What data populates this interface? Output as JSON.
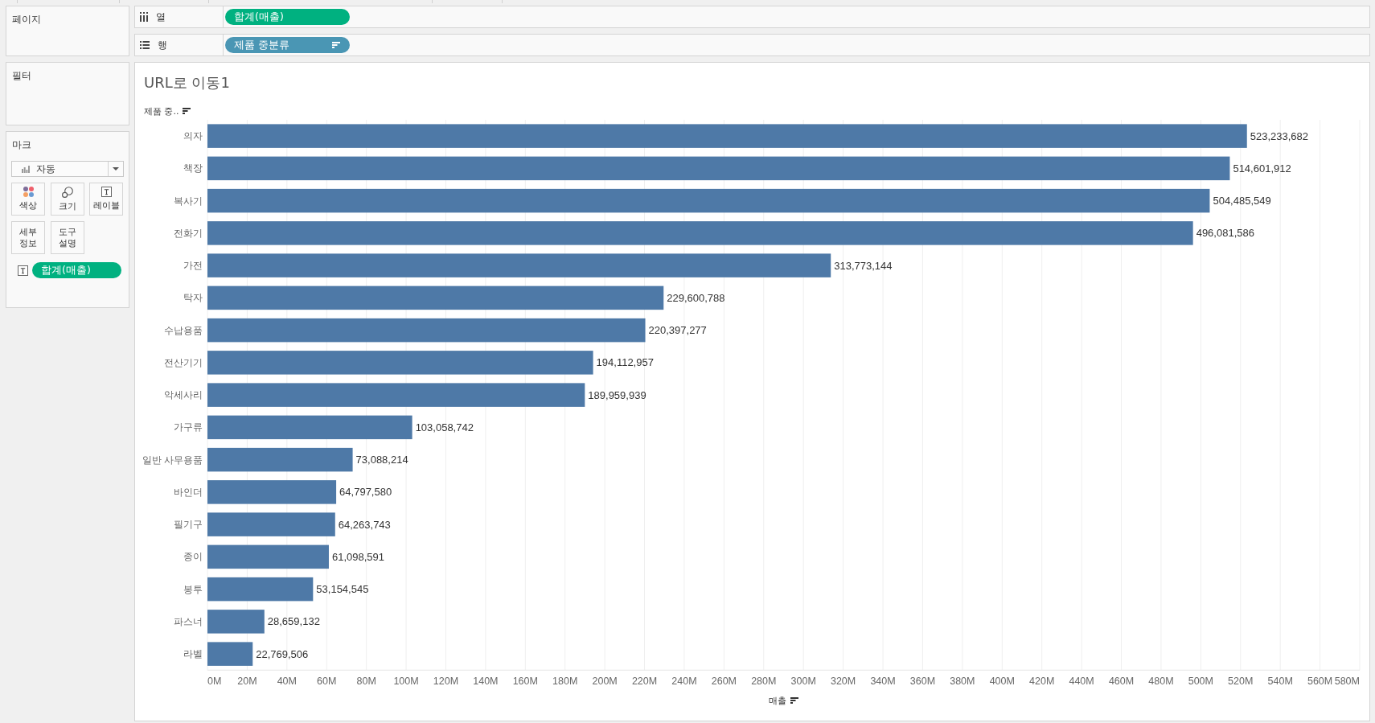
{
  "left_panel": {
    "cards": [
      {
        "kind": "pages",
        "title": "페이지"
      },
      {
        "kind": "filters",
        "title": "필터"
      },
      {
        "kind": "marks",
        "title": "마크",
        "mark_type": "자동",
        "buttons": [
          {
            "kind": "color",
            "label": "색상"
          },
          {
            "kind": "size",
            "label": "크기"
          },
          {
            "kind": "label",
            "label": "레이블"
          },
          {
            "kind": "detail",
            "label": "세부 정보"
          },
          {
            "kind": "tooltip",
            "label": "도구 설명"
          }
        ],
        "fields": [
          {
            "kind": "label",
            "pill": {
              "text": "합계(매출)",
              "kind": "measure",
              "sorted": false
            }
          }
        ]
      }
    ]
  },
  "shelves": [
    {
      "kind": "columns",
      "label": "열",
      "pills": [
        {
          "text": "합계(매출)",
          "kind": "measure",
          "sorted": false
        }
      ]
    },
    {
      "kind": "rows",
      "label": "행",
      "pills": [
        {
          "text": "제품 중분류",
          "kind": "dimension",
          "sorted": true
        }
      ]
    }
  ],
  "view": {
    "title": "URL로 이동1",
    "row_header_sorted": true,
    "axis_title_sorted": true,
    "chart_data": {
      "type": "bar",
      "orientation": "horizontal",
      "grid": true,
      "ylabel": "제품 중..",
      "xlabel": "매출",
      "categories": [
        "의자",
        "책장",
        "복사기",
        "전화기",
        "가전",
        "탁자",
        "수납용품",
        "전산기기",
        "악세사리",
        "가구류",
        "일반 사무용품",
        "바인더",
        "필기구",
        "종이",
        "봉투",
        "파스너",
        "라벨"
      ],
      "values": [
        523233682,
        514601912,
        504485549,
        496081586,
        313773144,
        229600788,
        220397277,
        194112957,
        189959939,
        103058742,
        73088214,
        64797580,
        64263743,
        61098591,
        53154545,
        28659132,
        22769506
      ],
      "value_labels": [
        "523,233,682",
        "514,601,912",
        "504,485,549",
        "496,081,586",
        "313,773,144",
        "229,600,788",
        "220,397,277",
        "194,112,957",
        "189,959,939",
        "103,058,742",
        "73,088,214",
        "64,797,580",
        "64,263,743",
        "61,098,591",
        "53,154,545",
        "28,659,132",
        "22,769,506"
      ],
      "xlim": [
        0,
        580000000
      ],
      "xticks": [
        {
          "value": 0,
          "label": "0M"
        },
        {
          "value": 20000000,
          "label": "20M"
        },
        {
          "value": 40000000,
          "label": "40M"
        },
        {
          "value": 60000000,
          "label": "60M"
        },
        {
          "value": 80000000,
          "label": "80M"
        },
        {
          "value": 100000000,
          "label": "100M"
        },
        {
          "value": 120000000,
          "label": "120M"
        },
        {
          "value": 140000000,
          "label": "140M"
        },
        {
          "value": 160000000,
          "label": "160M"
        },
        {
          "value": 180000000,
          "label": "180M"
        },
        {
          "value": 200000000,
          "label": "200M"
        },
        {
          "value": 220000000,
          "label": "220M"
        },
        {
          "value": 240000000,
          "label": "240M"
        },
        {
          "value": 260000000,
          "label": "260M"
        },
        {
          "value": 280000000,
          "label": "280M"
        },
        {
          "value": 300000000,
          "label": "300M"
        },
        {
          "value": 320000000,
          "label": "320M"
        },
        {
          "value": 340000000,
          "label": "340M"
        },
        {
          "value": 360000000,
          "label": "360M"
        },
        {
          "value": 380000000,
          "label": "380M"
        },
        {
          "value": 400000000,
          "label": "400M"
        },
        {
          "value": 420000000,
          "label": "420M"
        },
        {
          "value": 440000000,
          "label": "440M"
        },
        {
          "value": 460000000,
          "label": "460M"
        },
        {
          "value": 480000000,
          "label": "480M"
        },
        {
          "value": 500000000,
          "label": "500M"
        },
        {
          "value": 520000000,
          "label": "520M"
        },
        {
          "value": 540000000,
          "label": "540M"
        },
        {
          "value": 560000000,
          "label": "560M"
        },
        {
          "value": 580000000,
          "label": "580M"
        }
      ]
    }
  }
}
